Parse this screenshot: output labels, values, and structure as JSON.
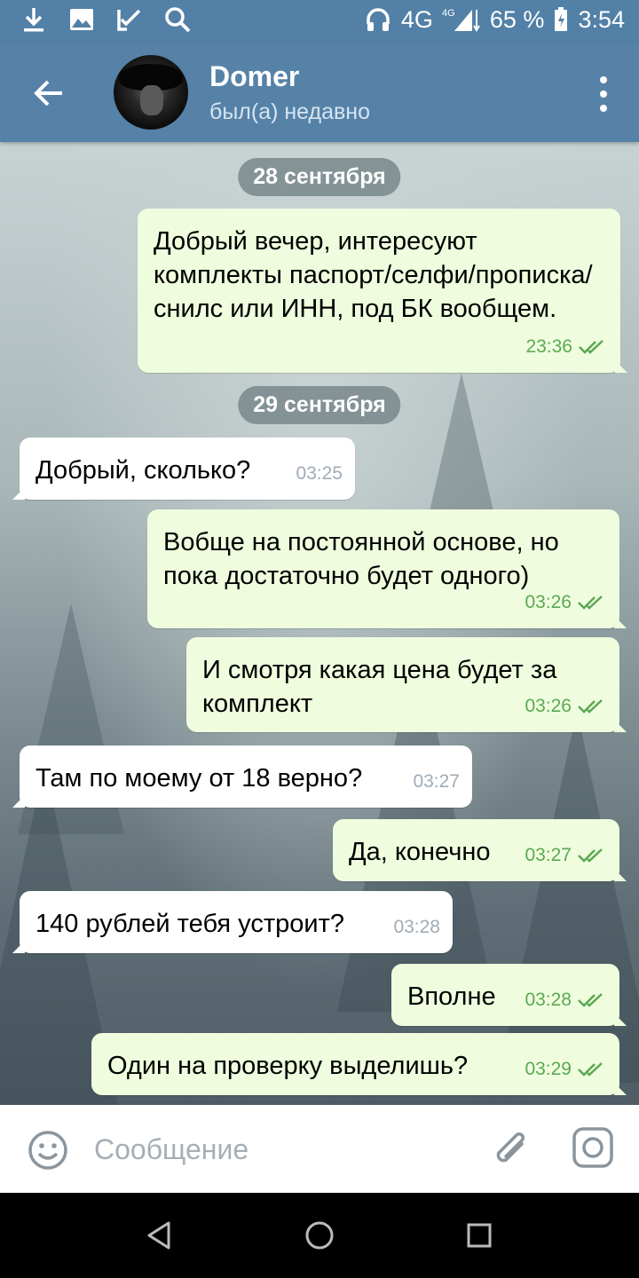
{
  "status_bar": {
    "network": "4G",
    "network_small": "4G",
    "battery_percent": "65 %",
    "time": "3:54",
    "icons": [
      "download-icon",
      "image-icon",
      "check-pencil-icon",
      "search-icon",
      "headphones-icon",
      "signal-icon",
      "battery-icon"
    ]
  },
  "header": {
    "name": "Domer",
    "status": "был(а) недавно",
    "icons": [
      "back-arrow-icon",
      "more-vert-icon"
    ]
  },
  "dates": [
    "28 сентября",
    "29 сентября"
  ],
  "messages": [
    {
      "dir": "out",
      "text": "Добрый вечер, интересуют комплекты паспорт/селфи/прописка/снилс или ИНН, под БК вообщем.",
      "time": "23:36",
      "read": true
    },
    {
      "dir": "in",
      "text": "Добрый, сколько?",
      "time": "03:25"
    },
    {
      "dir": "out",
      "text": "Вобще на постоянной основе, но пока достаточно будет одного)",
      "time": "03:26",
      "read": true
    },
    {
      "dir": "out",
      "text": "И смотря какая цена будет за комплект",
      "time": "03:26",
      "read": true
    },
    {
      "dir": "in",
      "text": "Там по моему от 18 верно?",
      "time": "03:27"
    },
    {
      "dir": "out",
      "text": "Да, конечно",
      "time": "03:27",
      "read": true
    },
    {
      "dir": "in",
      "text": "140 рублей тебя устроит?",
      "time": "03:28"
    },
    {
      "dir": "out",
      "text": "Вполне",
      "time": "03:28",
      "read": true
    },
    {
      "dir": "out",
      "text": "Один на проверку выделишь?",
      "time": "03:29",
      "read": true
    }
  ],
  "input": {
    "placeholder": "Сообщение",
    "value": "",
    "icons": [
      "emoji-icon",
      "paperclip-icon",
      "camera-icon"
    ]
  },
  "nav": {
    "icons": [
      "back-triangle-icon",
      "home-circle-icon",
      "recents-square-icon"
    ]
  },
  "colors": {
    "header": "#5682a8",
    "outgoing_bubble": "#effdde",
    "incoming_bubble": "#ffffff",
    "read_tick": "#5ca853"
  }
}
